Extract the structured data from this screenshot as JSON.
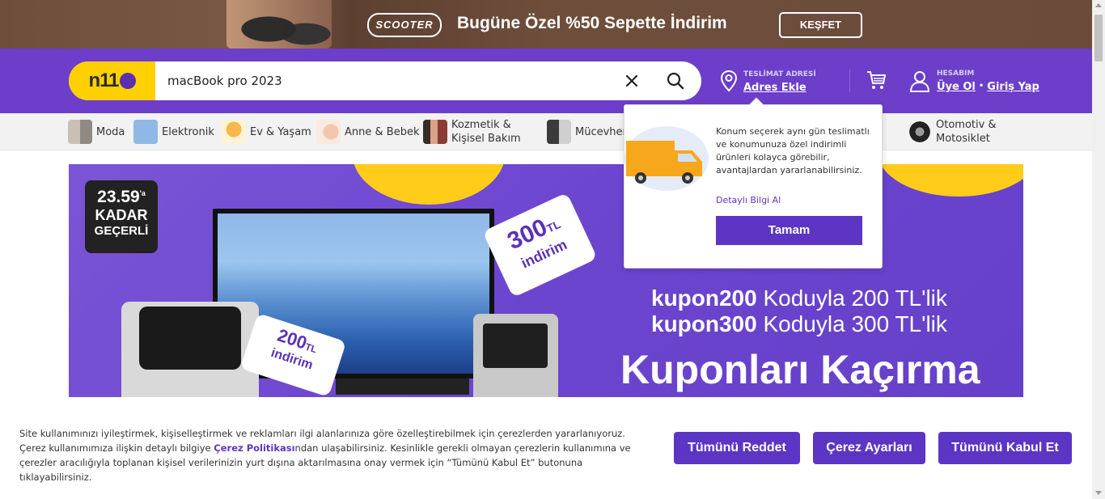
{
  "promo": {
    "brand": "SCOOTER",
    "message": "Bugüne Özel %50 Sepette İndirim",
    "cta": "KEŞFET"
  },
  "header": {
    "logo": "n11",
    "search_value": "macBook pro 2023",
    "address_label": "TESLİMAT ADRESİ",
    "address_link": "Adres Ekle",
    "account_label": "HESABIM",
    "signup": "Üye Ol",
    "login": "Giriş Yap"
  },
  "categories": [
    {
      "label": "Moda"
    },
    {
      "label": "Elektronik"
    },
    {
      "label": "Ev & Yaşam"
    },
    {
      "label": "Anne & Bebek"
    },
    {
      "line1": "Kozmetik &",
      "line2": "Kişisel Bakım"
    },
    {
      "label": "Mücevher"
    },
    {
      "line1": "Otomotiv &",
      "line2": "Motosiklet"
    }
  ],
  "hero": {
    "timer_time": "23.59",
    "timer_suffix": "'a",
    "timer_line2": "KADAR",
    "timer_line3": "GEÇERLİ",
    "tag300_amount": "300",
    "tag300_unit": "TL",
    "tag300_text": "indirim",
    "tag200_amount": "200",
    "tag200_unit": "TL",
    "tag200_text": "indirim",
    "line1_code": "kupon200",
    "line1_rest": " Koduyla 200 TL'lik",
    "line2_code": "kupon300",
    "line2_rest": " Koduyla 300 TL'lik",
    "headline": "Kuponları Kaçırma"
  },
  "popover": {
    "text": "Konum seçerek aynı gün teslimatlı ve konumunuza özel indirimli ürünleri kolayca görebilir, avantajlardan yararlanabilirsiniz.",
    "more_link": "Detaylı Bilgi Al",
    "ok_button": "Tamam"
  },
  "cookie": {
    "text_before": "Site kullanımınızı iyileştirmek, kişiselleştirmek ve reklamları ilgi alanlarınıza göre özelleştirebilmek için çerezlerden yararlanıyoruz. Çerez kullanımımıza ilişkin detaylı bilgiye ",
    "policy_link": "Çerez Politikası",
    "text_after": "ndan ulaşabilirsiniz. Kesinlikle gerekli olmayan çerezlerin kullanımına ve çerezler aracılığıyla toplanan kişisel verilerinizin yurt dışına aktarılmasına onay vermek için “Tümünü Kabul Et” butonuna tıklayabilirsiniz.",
    "reject_all": "Tümünü Reddet",
    "settings": "Çerez Ayarları",
    "accept_all": "Tümünü Kabul Et"
  },
  "colors": {
    "brand_purple": "#6c3ec9",
    "button_purple": "#5c35c4",
    "logo_yellow": "#ffd000"
  }
}
